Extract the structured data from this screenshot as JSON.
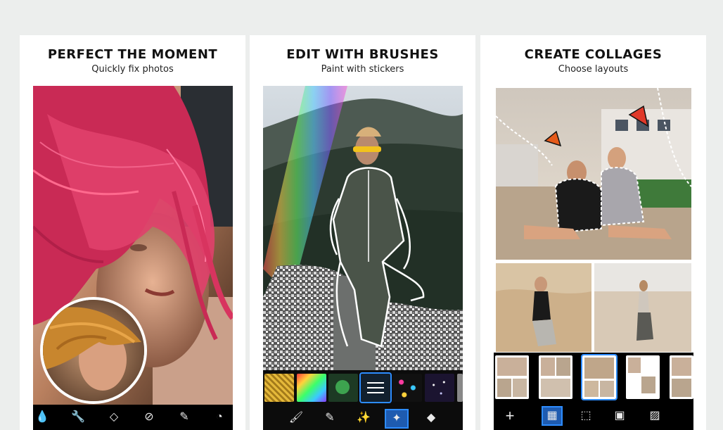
{
  "panels": [
    {
      "title": "PERFECT THE MOMENT",
      "subtitle": "Quickly fix photos"
    },
    {
      "title": "EDIT WITH BRUSHES",
      "subtitle": "Paint with stickers"
    },
    {
      "title": "CREATE COLLAGES",
      "subtitle": "Choose layouts"
    }
  ],
  "p1_tools": [
    "drop-icon",
    "wrench-icon",
    "diamond-icon",
    "bandage-icon",
    "lipstick-icon",
    "stickers-icon"
  ],
  "p2_thumbs": [
    "gold-glitter",
    "rainbow",
    "clover",
    "adjust-selected",
    "confetti",
    "stars"
  ],
  "p2_tools": [
    "brush-icon",
    "erase-brush-icon",
    "magic-wand-icon",
    "sticker-brush-icon",
    "eraser-icon"
  ],
  "p3_layouts": [
    "layout-1",
    "layout-2",
    "layout-3-selected",
    "layout-4",
    "layout-5"
  ],
  "p3_toolbar": {
    "add_symbol": "+"
  },
  "colors": {
    "accent": "#2d8cff",
    "hair": "#d8345f",
    "background": "#eceeed"
  }
}
